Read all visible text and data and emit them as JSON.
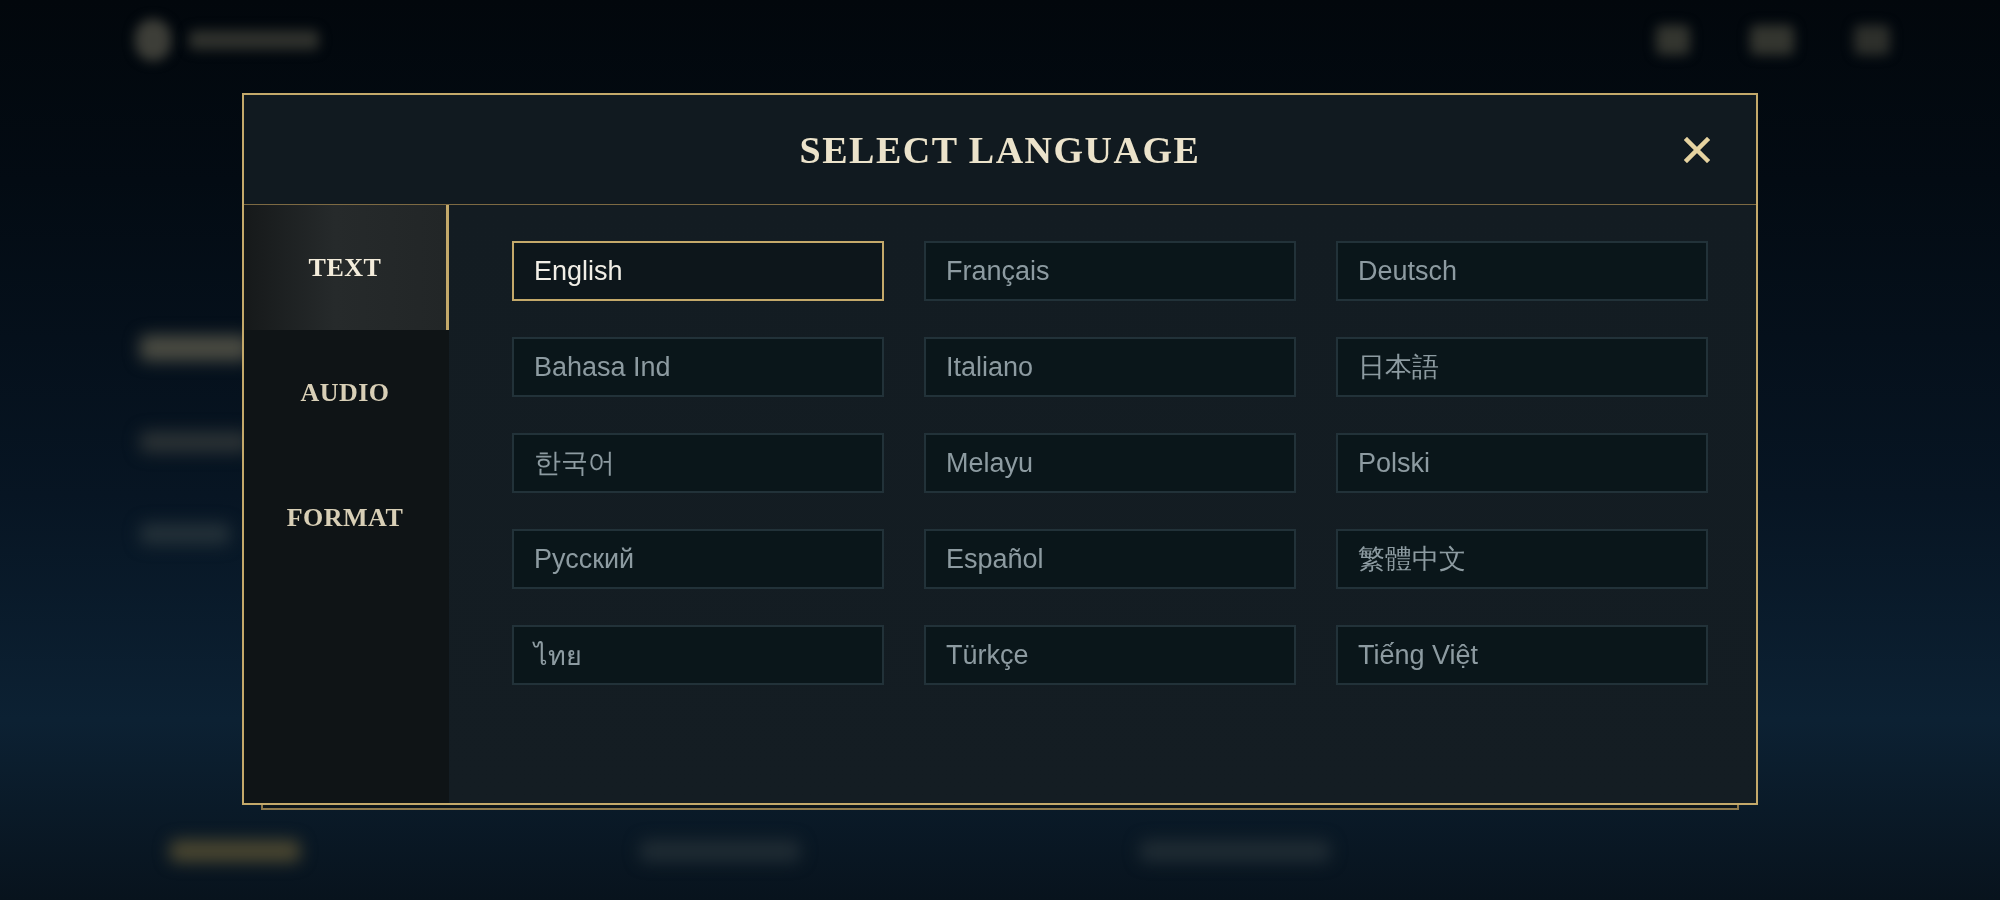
{
  "dialog": {
    "title": "SELECT LANGUAGE"
  },
  "tabs": [
    {
      "label": "TEXT",
      "selected": true
    },
    {
      "label": "AUDIO",
      "selected": false
    },
    {
      "label": "FORMAT",
      "selected": false
    }
  ],
  "languages": [
    {
      "label": "English",
      "selected": true
    },
    {
      "label": "Français",
      "selected": false
    },
    {
      "label": "Deutsch",
      "selected": false
    },
    {
      "label": "Bahasa Ind",
      "selected": false
    },
    {
      "label": "Italiano",
      "selected": false
    },
    {
      "label": "日本語",
      "selected": false
    },
    {
      "label": "한국어",
      "selected": false
    },
    {
      "label": "Melayu",
      "selected": false
    },
    {
      "label": "Polski",
      "selected": false
    },
    {
      "label": "Русский",
      "selected": false
    },
    {
      "label": "Español",
      "selected": false
    },
    {
      "label": "繁體中文",
      "selected": false
    },
    {
      "label": "ไทย",
      "selected": false
    },
    {
      "label": "Türkçe",
      "selected": false
    },
    {
      "label": "Tiếng Việt",
      "selected": false
    }
  ]
}
